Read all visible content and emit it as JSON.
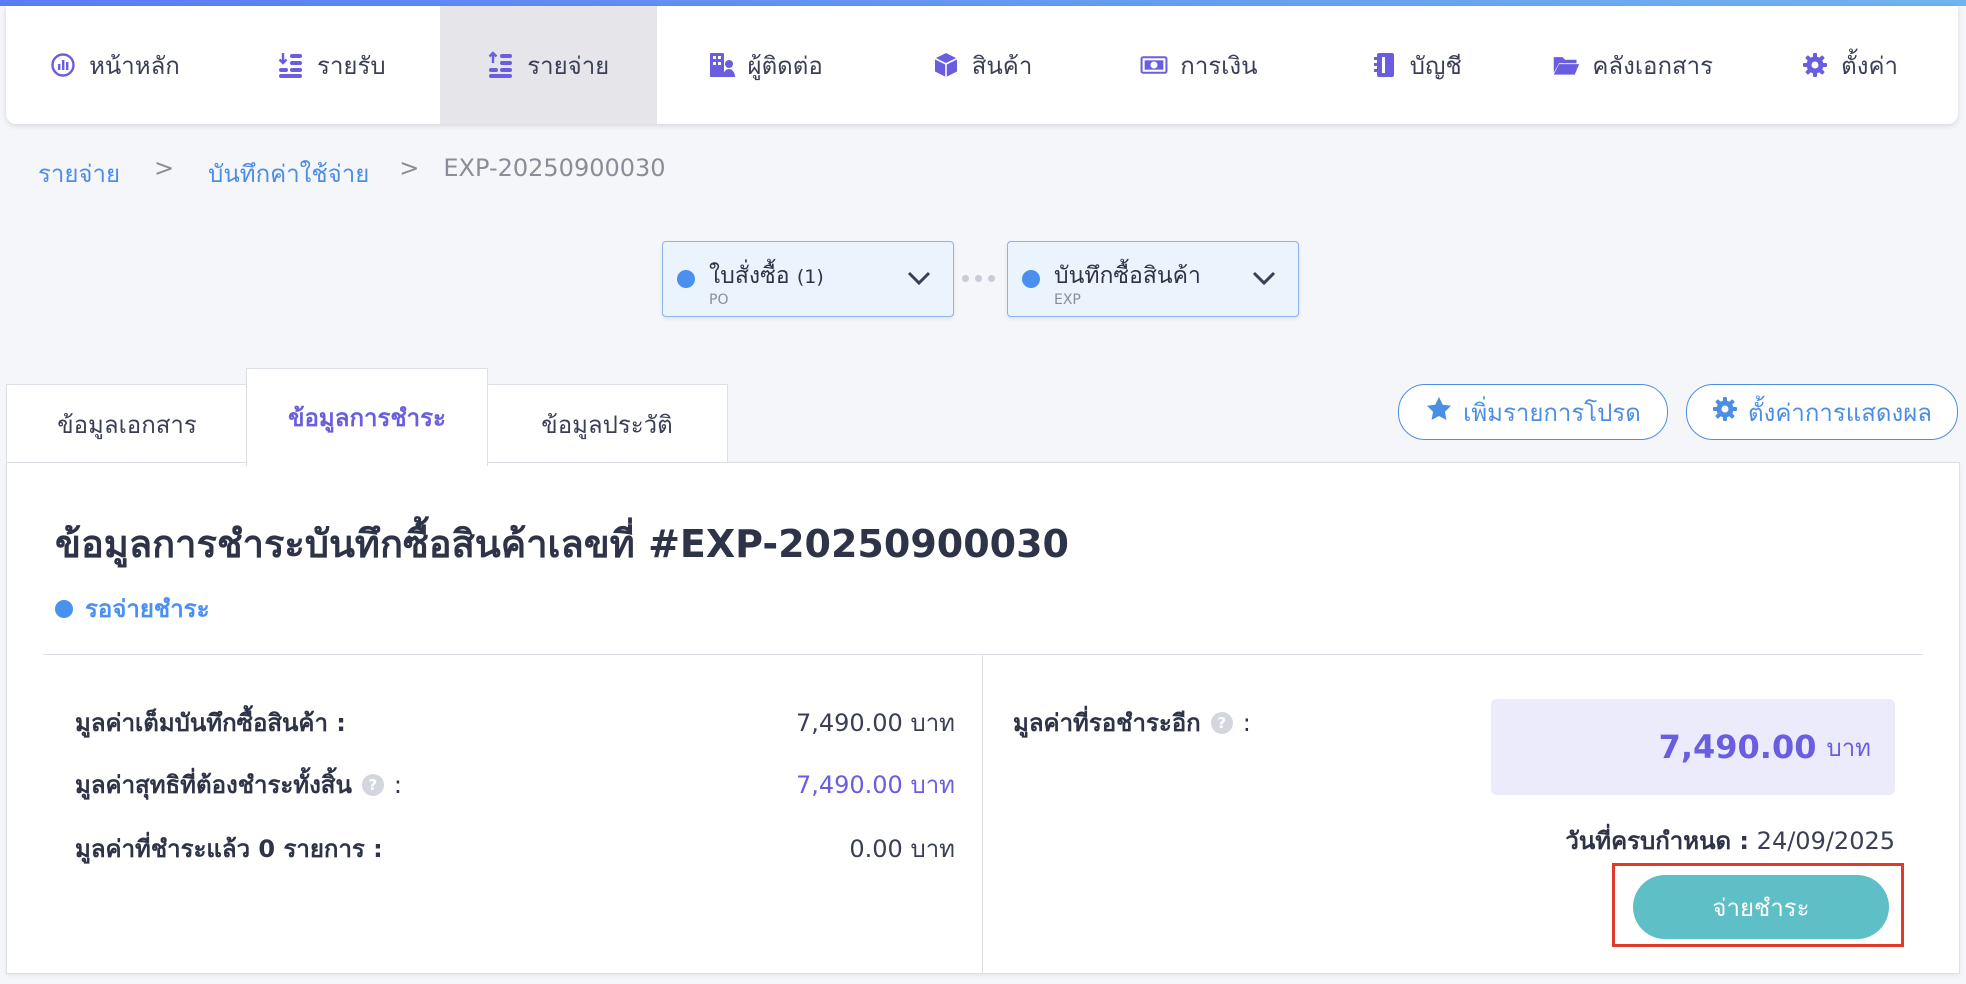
{
  "nav": {
    "items": [
      {
        "label": "หน้าหลัก",
        "icon": "dashboard-icon"
      },
      {
        "label": "รายรับ",
        "icon": "income-icon"
      },
      {
        "label": "รายจ่าย",
        "icon": "expense-icon",
        "active": true
      },
      {
        "label": "ผู้ติดต่อ",
        "icon": "contacts-icon"
      },
      {
        "label": "สินค้า",
        "icon": "box-icon"
      },
      {
        "label": "การเงิน",
        "icon": "money-icon"
      },
      {
        "label": "บัญชี",
        "icon": "ledger-icon"
      },
      {
        "label": "คลังเอกสาร",
        "icon": "folder-icon"
      },
      {
        "label": "ตั้งค่า",
        "icon": "gear-icon"
      }
    ]
  },
  "breadcrumb": {
    "items": [
      "รายจ่าย",
      "บันทึกค่าใช้จ่าย",
      "EXP-20250900030"
    ],
    "separator": ">"
  },
  "flow": {
    "po": {
      "title": "ใบสั่งซื้อ",
      "count": "(1)",
      "code": "PO"
    },
    "exp": {
      "title": "บันทึกซื้อสินค้า",
      "code": "EXP"
    }
  },
  "tabs": [
    "ข้อมูลเอกสาร",
    "ข้อมูลการชำระ",
    "ข้อมูลประวัติ"
  ],
  "actions": {
    "favorite": "เพิ่มรายการโปรด",
    "display_settings": "ตั้งค่าการแสดงผล"
  },
  "payment": {
    "title": "ข้อมูลการชำระบันทึกซื้อสินค้าเลขที่ #EXP-20250900030",
    "status": "รอจ่ายชำระ",
    "rows": [
      {
        "label": "มูลค่าเต็มบันทึกซื้อสินค้า :",
        "value": "7,490.00 บาท"
      },
      {
        "label": "มูลค่าสุทธิที่ต้องชำระทั้งสิ้น",
        "value": "7,490.00 บาท"
      },
      {
        "label": "มูลค่าที่ชำระแล้ว 0 รายการ :",
        "value": "0.00 บาท"
      }
    ],
    "colon": ":",
    "help_glyph": "?",
    "pending_label": "มูลค่าที่รอชำระอีก",
    "pending_amount": "7,490.00",
    "pending_unit": "บาท",
    "due_label": "วันที่ครบกำหนด :",
    "due_date": "24/09/2025",
    "pay_button": "จ่ายชำระ"
  },
  "colors": {
    "accent": "#6a5ee0",
    "link": "#4c8ee6",
    "pay_button": "#5fbfc6",
    "highlight": "#e03a2a"
  }
}
